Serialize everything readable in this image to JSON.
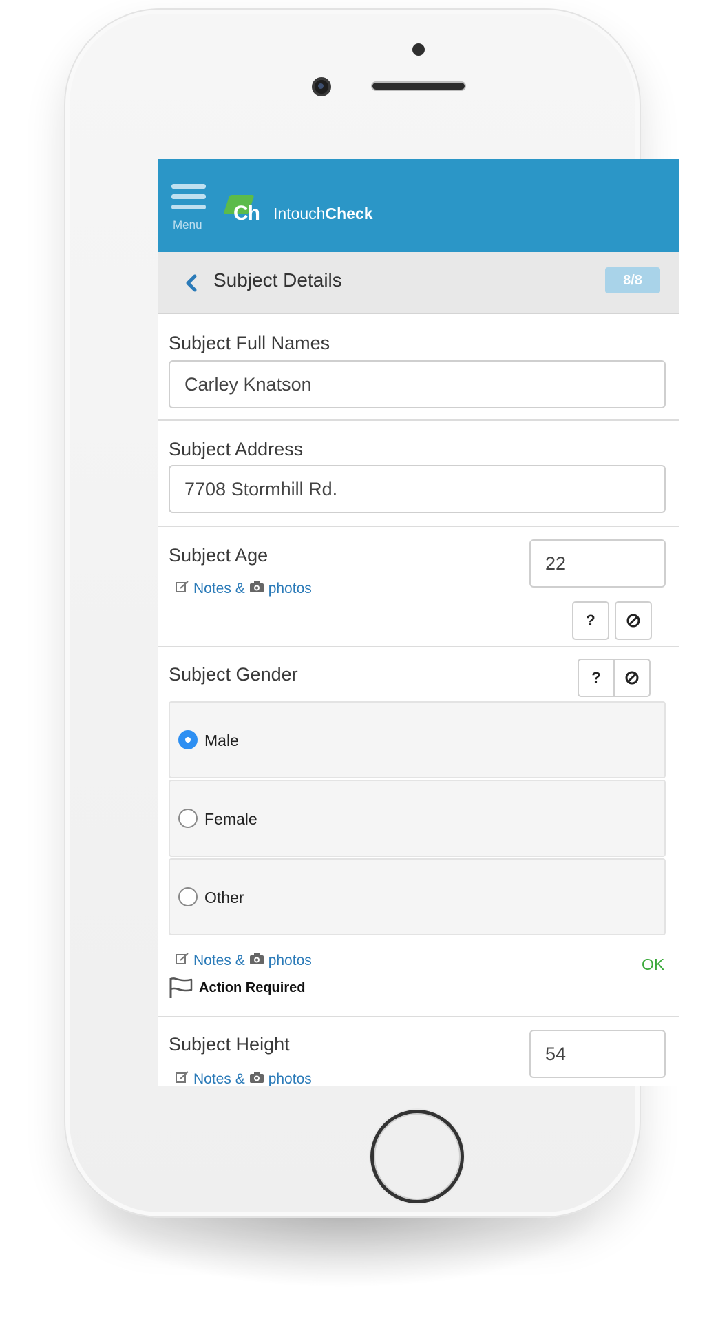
{
  "app": {
    "menu_label": "Menu",
    "logo_mark": "Ch",
    "brand_prefix": "Intouch",
    "brand_suffix": "Check"
  },
  "subheader": {
    "title": "Subject Details",
    "step_badge": "8/8"
  },
  "fields": {
    "full_names": {
      "label": "Subject Full Names",
      "value": "Carley Knatson"
    },
    "address": {
      "label": "Subject Address",
      "value": "7708 Stormhill Rd."
    },
    "age": {
      "label": "Subject Age",
      "value": "22"
    },
    "gender": {
      "label": "Subject Gender",
      "options": [
        {
          "label": "Male",
          "selected": true
        },
        {
          "label": "Female",
          "selected": false
        },
        {
          "label": "Other",
          "selected": false
        }
      ],
      "status": "OK",
      "action_required": "Action Required"
    },
    "height": {
      "label": "Subject Height",
      "value": "54"
    }
  },
  "notes": {
    "notes_text": "Notes &",
    "photos_text": "photos"
  },
  "buttons": {
    "help_label": "?",
    "na_label": "⊘"
  },
  "colors": {
    "header_bg": "#2b96c7",
    "badge_bg": "#a9d3e9",
    "link": "#2a7ab8",
    "radio_selected": "#2d8ff2",
    "ok_green": "#3aa93a",
    "logo_green": "#5cbb4a"
  }
}
